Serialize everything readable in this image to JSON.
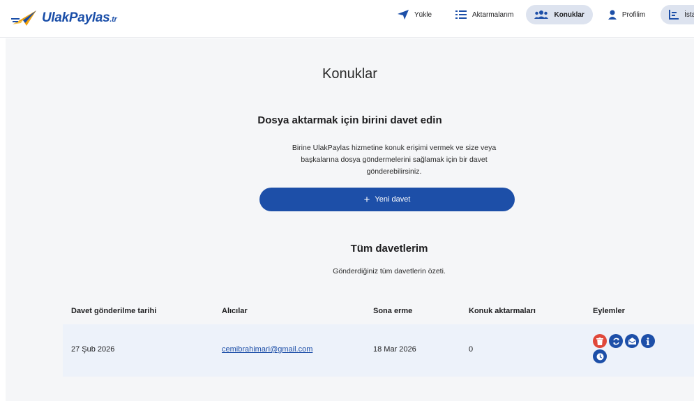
{
  "brand": {
    "name": "UlakPaylas",
    "tld": ".tr",
    "accent": "#1d4fa8"
  },
  "nav": {
    "items": [
      {
        "label": "Yükle",
        "icon": "paper-plane-icon"
      },
      {
        "label": "Aktarmalarım",
        "icon": "list-icon"
      },
      {
        "label": "Konuklar",
        "icon": "users-icon",
        "active": true
      },
      {
        "label": "Profilim",
        "icon": "user-icon"
      },
      {
        "label": "İstati",
        "icon": "chart-icon"
      }
    ]
  },
  "page": {
    "title": "Konuklar",
    "invite_heading": "Dosya aktarmak için birini davet edin",
    "invite_desc_line1": "Birine UlakPaylas hizmetine konuk erişimi vermek ve size veya",
    "invite_desc_line2": "başkalarına dosya göndermelerini sağlamak için bir davet",
    "invite_desc_line3": "gönderebilirsiniz.",
    "new_invite_label": "Yeni davet",
    "all_heading": "Tüm davetlerim",
    "all_desc": "Gönderdiğiniz tüm davetlerin özeti."
  },
  "table": {
    "headers": [
      "Davet gönderilme tarihi",
      "Alıcılar",
      "Sona erme",
      "Konuk aktarmaları",
      "Eylemler"
    ],
    "rows": [
      {
        "sent": "27 Şub 2026",
        "recipient": "cemibrahimari@gmail.com",
        "expires": "18 Mar 2026",
        "guest_transfers": "0",
        "actions": [
          "trash-icon",
          "resend-icon",
          "envelope-open-icon",
          "info-icon",
          "clock-icon"
        ]
      }
    ]
  },
  "colors": {
    "primary": "#1d4fa8",
    "danger": "#e0483a",
    "row_bg": "#edf2fa",
    "page_bg": "#f5f6f8",
    "nav_active_bg": "#dde3ef"
  }
}
